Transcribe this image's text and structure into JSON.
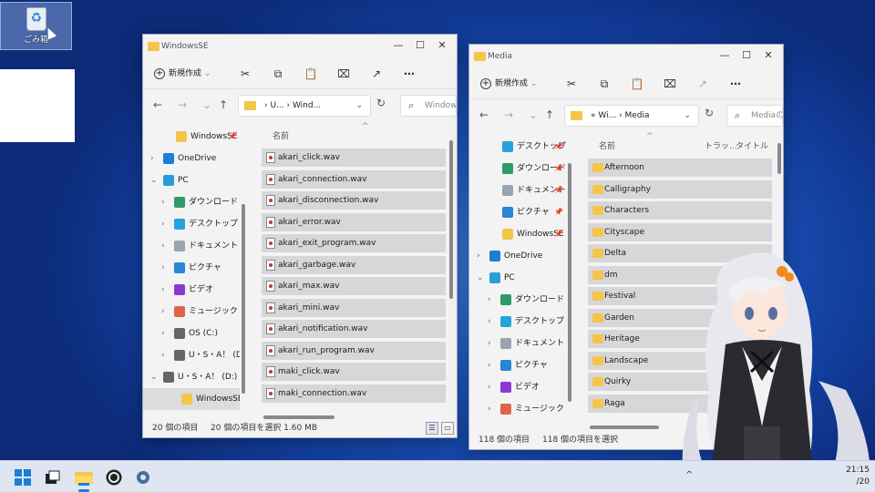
{
  "desktop": {
    "recycle_bin_label": "ごみ箱"
  },
  "win1": {
    "title": "WindowsSE",
    "new_label": "新規作成",
    "breadcrumb": [
      "U...",
      "Wind..."
    ],
    "search_placeholder": "Window",
    "column_name": "名前",
    "nav": [
      {
        "label": "WindowsSE",
        "icon": "folder-icon",
        "pinned": true
      },
      {
        "label": "OneDrive",
        "icon": "cloud-icon"
      },
      {
        "label": "PC",
        "icon": "pc-icon",
        "expanded": true
      },
      {
        "label": "ダウンロード",
        "icon": "download-icon"
      },
      {
        "label": "デスクトップ",
        "icon": "desktop-icon"
      },
      {
        "label": "ドキュメント",
        "icon": "document-icon"
      },
      {
        "label": "ピクチャ",
        "icon": "pictures-icon"
      },
      {
        "label": "ビデオ",
        "icon": "video-icon"
      },
      {
        "label": "ミュージック",
        "icon": "music-icon"
      },
      {
        "label": "OS (C:)",
        "icon": "drive-icon"
      },
      {
        "label": "U・S・A！ (D:)",
        "icon": "drive-icon"
      },
      {
        "label": "U・S・A！ (D:)",
        "icon": "drive-icon",
        "expanded": true
      },
      {
        "label": "WindowsSE",
        "icon": "folder-icon",
        "selected": true
      }
    ],
    "files": [
      "akari_click.wav",
      "akari_connection.wav",
      "akari_disconnection.wav",
      "akari_error.wav",
      "akari_exit_program.wav",
      "akari_garbage.wav",
      "akari_max.wav",
      "akari_mini.wav",
      "akari_notification.wav",
      "akari_run_program.wav",
      "maki_click.wav",
      "maki_connection.wav"
    ],
    "status_count": "20 個の項目",
    "status_selected": "20 個の項目を選択  1.60 MB"
  },
  "win2": {
    "title": "Media",
    "new_label": "新規作成",
    "breadcrumb": [
      "Wi...",
      "Media"
    ],
    "search_placeholder": "Mediaの",
    "column_name": "名前",
    "column_track": "トラッ...",
    "column_title": "タイトル",
    "nav": [
      {
        "label": "デスクトップ",
        "icon": "desktop-icon",
        "pinned": true
      },
      {
        "label": "ダウンロード",
        "icon": "download-icon",
        "pinned": true
      },
      {
        "label": "ドキュメント",
        "icon": "document-icon",
        "pinned": true
      },
      {
        "label": "ピクチャ",
        "icon": "pictures-icon",
        "pinned": true
      },
      {
        "label": "WindowsSE",
        "icon": "folder-icon",
        "pinned": true
      },
      {
        "label": "OneDrive",
        "icon": "cloud-icon"
      },
      {
        "label": "PC",
        "icon": "pc-icon",
        "expanded": true
      },
      {
        "label": "ダウンロード",
        "icon": "download-icon"
      },
      {
        "label": "デスクトップ",
        "icon": "desktop-icon"
      },
      {
        "label": "ドキュメント",
        "icon": "document-icon"
      },
      {
        "label": "ピクチャ",
        "icon": "pictures-icon"
      },
      {
        "label": "ビデオ",
        "icon": "video-icon"
      },
      {
        "label": "ミュージック",
        "icon": "music-icon"
      }
    ],
    "folders": [
      "Afternoon",
      "Calligraphy",
      "Characters",
      "Cityscape",
      "Delta",
      "dm",
      "Festival",
      "Garden",
      "Heritage",
      "Landscape",
      "Quirky",
      "Raga"
    ],
    "status_count": "118 個の項目",
    "status_selected": "118 個の項目を選択"
  },
  "taskbar": {
    "time": "21:15",
    "date": "/20"
  },
  "colors": {
    "folder": "#f4c54b",
    "selection": "#d7d7d9",
    "taskbar": "#dfe6f2"
  }
}
